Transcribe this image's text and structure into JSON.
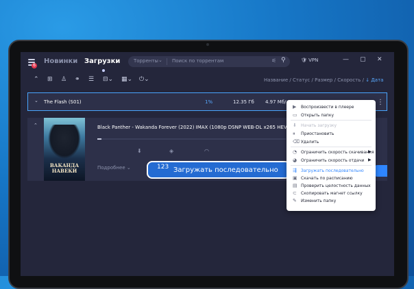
{
  "app": {
    "badge_count": "6",
    "nav": {
      "news": "Новинки",
      "downloads": "Загрузки"
    },
    "search": {
      "category": "Торренты",
      "placeholder": "Поиск по торрентам"
    },
    "vpn": "VPN",
    "window_controls": {
      "minimize": "—",
      "maximize": "▢",
      "close": "✕"
    },
    "toolbar_icons": [
      "collapse-icon",
      "add-icon",
      "create-torrent-icon",
      "magnet-link-icon",
      "list-view-icon",
      "calendar-icon",
      "power-icon"
    ],
    "sort": {
      "items": [
        "Название",
        "Статус",
        "Размер",
        "Скорость"
      ],
      "active": "Дата",
      "separator": "/",
      "arrow": "↓"
    }
  },
  "torrents": [
    {
      "title": "The Flash (S01)",
      "percent": "1%",
      "size": "12.35 Гб",
      "speed": "4.97 Мб/"
    },
    {
      "title": "Black Panther - Wakanda Forever (2022) IMAX (1080p DSNP WEB-DL x265 HEVC 10",
      "poster_title": "ВАКАНДА НАВЕКИ",
      "more_label": "Подробнее",
      "progress": 0.02
    }
  ],
  "callout": {
    "icon": "123",
    "text": "Загружать последовательно"
  },
  "context_menu": {
    "items": [
      {
        "icon": "play-icon",
        "label": "Воспроизвести в плеере",
        "state": "normal"
      },
      {
        "icon": "folder-icon",
        "label": "Открыть папку",
        "state": "normal"
      },
      {
        "icon": "download-icon",
        "label": "Начать загрузку",
        "state": "disabled"
      },
      {
        "icon": "pause-icon",
        "label": "Приостановить",
        "state": "normal"
      },
      {
        "icon": "trash-icon",
        "label": "Удалить",
        "state": "normal"
      },
      {
        "icon": "speed-down-icon",
        "label": "Ограничить скорость скачивания",
        "state": "submenu"
      },
      {
        "icon": "speed-up-icon",
        "label": "Ограничить скорость отдачи",
        "state": "submenu"
      },
      {
        "icon": "sequential-icon",
        "label": "Загружать последовательно",
        "state": "highlighted"
      },
      {
        "icon": "schedule-icon",
        "label": "Скачать по расписанию",
        "state": "normal"
      },
      {
        "icon": "verify-icon",
        "label": "Проверить целостность данных",
        "state": "normal"
      },
      {
        "icon": "magnet-icon",
        "label": "Скопировать магнет ссылку",
        "state": "normal"
      },
      {
        "icon": "edit-folder-icon",
        "label": "Изменить папку",
        "state": "normal"
      }
    ]
  },
  "colors": {
    "accent": "#2f86ff",
    "panel": "#2d3049",
    "background": "#24263b"
  }
}
